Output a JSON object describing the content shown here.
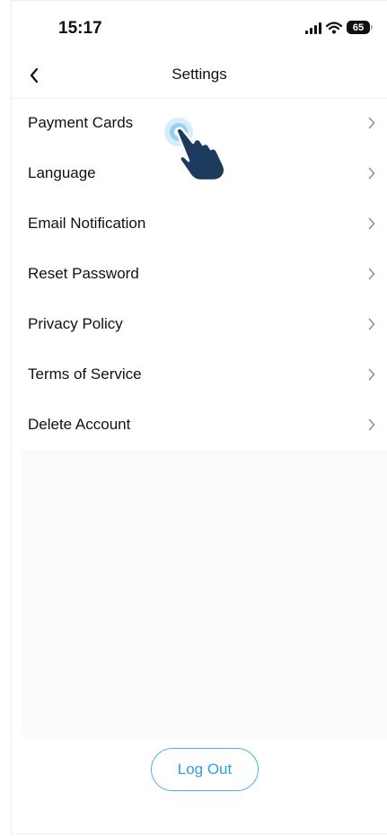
{
  "status_bar": {
    "time": "15:17",
    "battery_level": "65",
    "icons": [
      "signal-icon",
      "wifi-icon",
      "battery-icon"
    ]
  },
  "nav": {
    "title": "Settings",
    "back_icon": "back-chevron-icon"
  },
  "settings": {
    "items": [
      {
        "label": "Payment Cards"
      },
      {
        "label": "Language"
      },
      {
        "label": "Email Notification"
      },
      {
        "label": "Reset Password"
      },
      {
        "label": "Privacy Policy"
      },
      {
        "label": "Terms of Service"
      },
      {
        "label": "Delete Account"
      }
    ],
    "item_icon": "chevron-right-icon"
  },
  "footer": {
    "logout_label": "Log Out"
  },
  "colors": {
    "accent": "#2f9fde",
    "accent_border": "#4fb3e6",
    "text": "#111111",
    "chevron": "#8e8e93",
    "hand_cursor": "#1b3a5c"
  }
}
